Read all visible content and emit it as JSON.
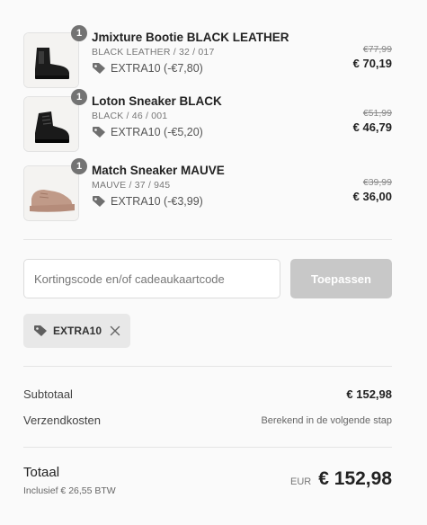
{
  "items": [
    {
      "quantity": "1",
      "name": "Jmixture Bootie BLACK LEATHER",
      "variant": "BLACK LEATHER / 32 / 017",
      "discount": "EXTRA10 (-€7,80)",
      "original_price": "€77,99",
      "price": "€ 70,19",
      "image": "black-chelsea-boot"
    },
    {
      "quantity": "1",
      "name": "Loton Sneaker BLACK",
      "variant": "BLACK / 46 / 001",
      "discount": "EXTRA10 (-€5,20)",
      "original_price": "€51,99",
      "price": "€ 46,79",
      "image": "black-high-sneaker"
    },
    {
      "quantity": "1",
      "name": "Match Sneaker MAUVE",
      "variant": "MAUVE / 37 / 945",
      "discount": "EXTRA10 (-€3,99)",
      "original_price": "€39,99",
      "price": "€ 36,00",
      "image": "mauve-chunky-sneaker"
    }
  ],
  "discount_form": {
    "placeholder": "Kortingscode en/of cadeaukaartcode",
    "value": "",
    "apply_label": "Toepassen"
  },
  "applied_code": {
    "label": "EXTRA10"
  },
  "summary": {
    "subtotal_label": "Subtotaal",
    "subtotal_value": "€ 152,98",
    "shipping_label": "Verzendkosten",
    "shipping_value": "Berekend in de volgende stap",
    "total_label": "Totaal",
    "tax_note": "Inclusief € 26,55 BTW",
    "currency": "EUR",
    "total_value": "€ 152,98"
  },
  "colors": {
    "background": "#fafafa",
    "quantity_badge": "#737373",
    "apply_button_disabled": "#c8c8c8",
    "chip_background": "#e8e8e8"
  }
}
